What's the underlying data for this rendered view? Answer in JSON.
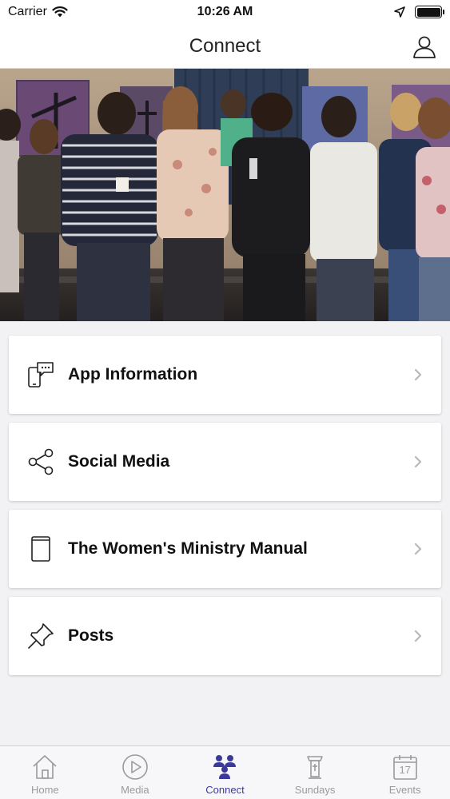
{
  "status_bar": {
    "carrier": "Carrier",
    "time": "10:26 AM"
  },
  "header": {
    "title": "Connect",
    "profile_icon": "person-icon"
  },
  "hero": {
    "description_icon": "photo"
  },
  "menu": {
    "items": [
      {
        "label": "App Information",
        "icon": "phone-chat-icon"
      },
      {
        "label": "Social Media",
        "icon": "share-icon"
      },
      {
        "label": "The Women's Ministry Manual",
        "icon": "book-icon"
      },
      {
        "label": "Posts",
        "icon": "pin-icon"
      }
    ]
  },
  "tabs": [
    {
      "label": "Home",
      "icon": "home-icon",
      "active": false
    },
    {
      "label": "Media",
      "icon": "play-icon",
      "active": false
    },
    {
      "label": "Connect",
      "icon": "people-icon",
      "active": true
    },
    {
      "label": "Sundays",
      "icon": "pulpit-icon",
      "active": false
    },
    {
      "label": "Events",
      "icon": "calendar-icon",
      "active": false,
      "badge": "17"
    }
  ],
  "colors": {
    "accent": "#3b3a9a",
    "inactive": "#9a9a9e",
    "background": "#f2f2f4"
  }
}
